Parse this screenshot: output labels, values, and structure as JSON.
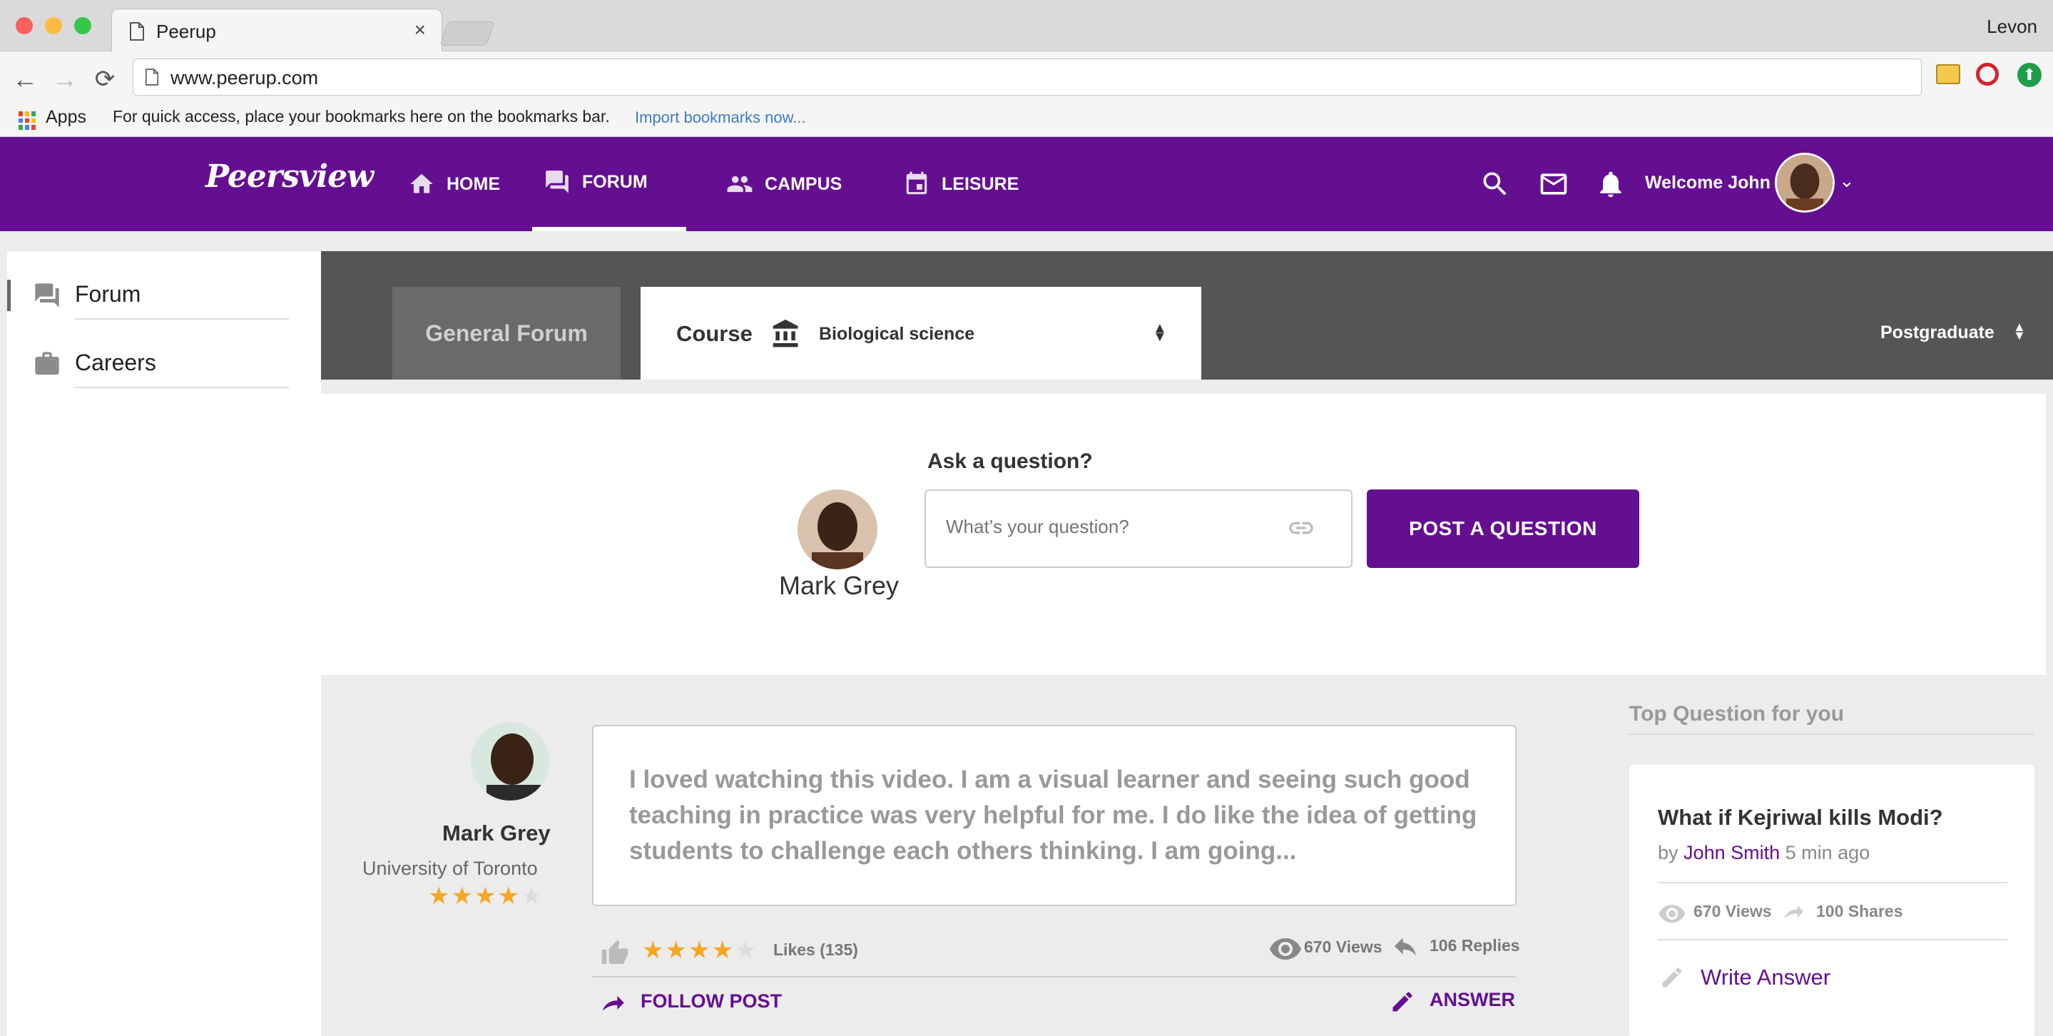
{
  "browser": {
    "tab_title": "Peerup",
    "tab_close": "×",
    "profile_name": "Levon",
    "url": "www.peerup.com",
    "back": "←",
    "forward": "→",
    "reload": "⟳",
    "bookmarks": {
      "apps_label": "Apps",
      "hint": "For quick access, place your bookmarks here on the bookmarks bar.",
      "import_link": "Import bookmarks now..."
    }
  },
  "header": {
    "logo_text": "Peersview",
    "nav": [
      {
        "label": "HOME",
        "icon": "home-icon"
      },
      {
        "label": "FORUM",
        "icon": "forum-icon",
        "active": true
      },
      {
        "label": "CAMPUS",
        "icon": "people-icon"
      },
      {
        "label": "LEISURE",
        "icon": "calendar-icon"
      }
    ],
    "welcome": "Welcome John",
    "chevron": "⌄"
  },
  "sidebar": {
    "items": [
      {
        "label": "Forum",
        "icon": "forum-icon",
        "active": true
      },
      {
        "label": "Careers",
        "icon": "briefcase-icon"
      }
    ]
  },
  "forum_tabs": {
    "general": "General Forum",
    "course_label": "Course",
    "course_value": "Biological science",
    "level_value": "Postgraduate",
    "sort_glyph": "▲▼"
  },
  "ask": {
    "title": "Ask a question?",
    "user_name": "Mark Grey",
    "placeholder": "What’s your question?",
    "button": "POST A QUESTION"
  },
  "post": {
    "author": "Mark Grey",
    "university": "University of Toronto",
    "author_rating": 4,
    "author_stars": "★★★★★",
    "text": "I loved watching this video. I am a visual learner and seeing such good teaching in practice was very helpful for me. I do like the idea of getting students to challenge each others thinking. I am going...",
    "rating": 4,
    "rating_stars": "★★★★★",
    "likes": "Likes (135)",
    "views": "670 Views",
    "replies": "106 Replies",
    "follow": "FOLLOW POST",
    "answer": "ANSWER"
  },
  "top_question": {
    "section_title": "Top Question for you",
    "question": "What if Kejriwal kills Modi?",
    "by": "by",
    "author": "John Smith",
    "time": "5 min ago",
    "views": "670 Views",
    "shares": "100 Shares",
    "write_answer": "Write Answer"
  },
  "colors": {
    "brand": "#640f92",
    "star": "#f5a623",
    "tab_bar": "#555555"
  }
}
